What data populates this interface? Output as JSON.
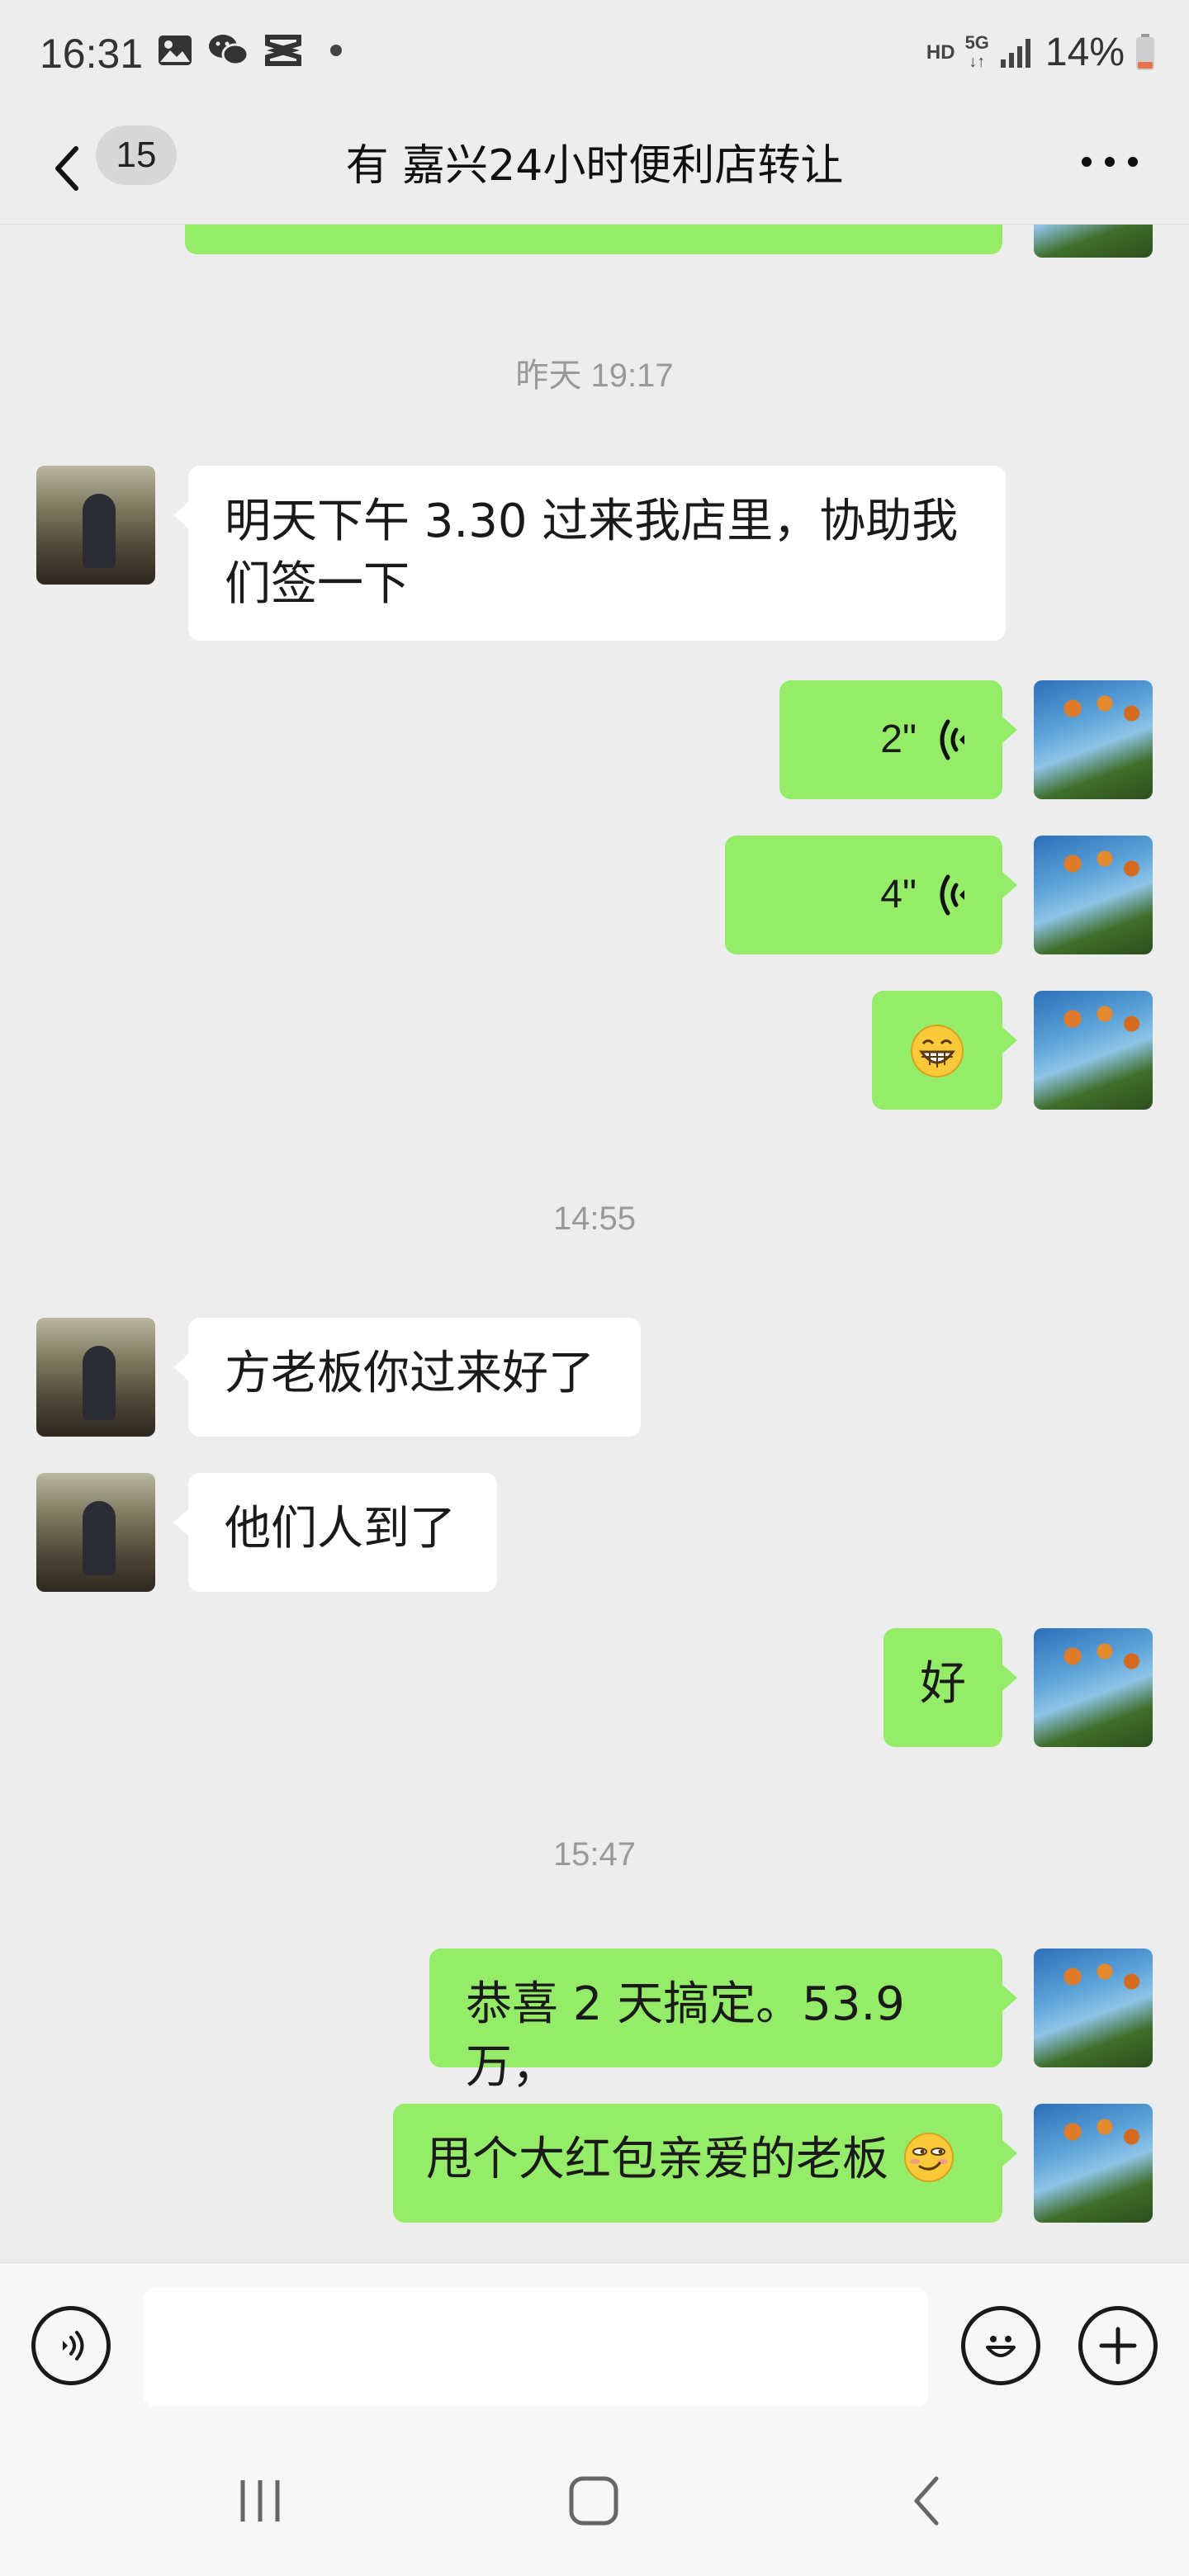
{
  "status_bar": {
    "time": "16:31",
    "network_hd": "HD",
    "network_5g": "5G",
    "battery": "14%"
  },
  "nav": {
    "back_badge": "15",
    "title": "有 嘉兴24小时便利店转让"
  },
  "timestamps": [
    "昨天 19:17",
    "14:55",
    "15:47"
  ],
  "messages": {
    "m1": "明天下午 3.30 过来我店里，协助我们签一下",
    "voice1": "2\"",
    "voice2": "4\"",
    "m3": "方老板你过来好了",
    "m4": "他们人到了",
    "m5": "好",
    "m6": "恭喜 2 天搞定。53.9 万，",
    "m7": "甩个大红包亲爱的老板"
  },
  "colors": {
    "self_bubble": "#95ec69",
    "other_bubble": "#ffffff",
    "background": "#ededed"
  },
  "icons": [
    "gallery-icon",
    "wechat-icon",
    "capcut-icon",
    "signal-icon",
    "battery-icon",
    "back-icon",
    "more-icon",
    "voice-wave-icon",
    "grin-emoji-icon",
    "smirk-emoji-icon",
    "voice-input-icon",
    "emoji-icon",
    "plus-icon",
    "recents-icon",
    "home-icon",
    "nav-back-icon"
  ]
}
